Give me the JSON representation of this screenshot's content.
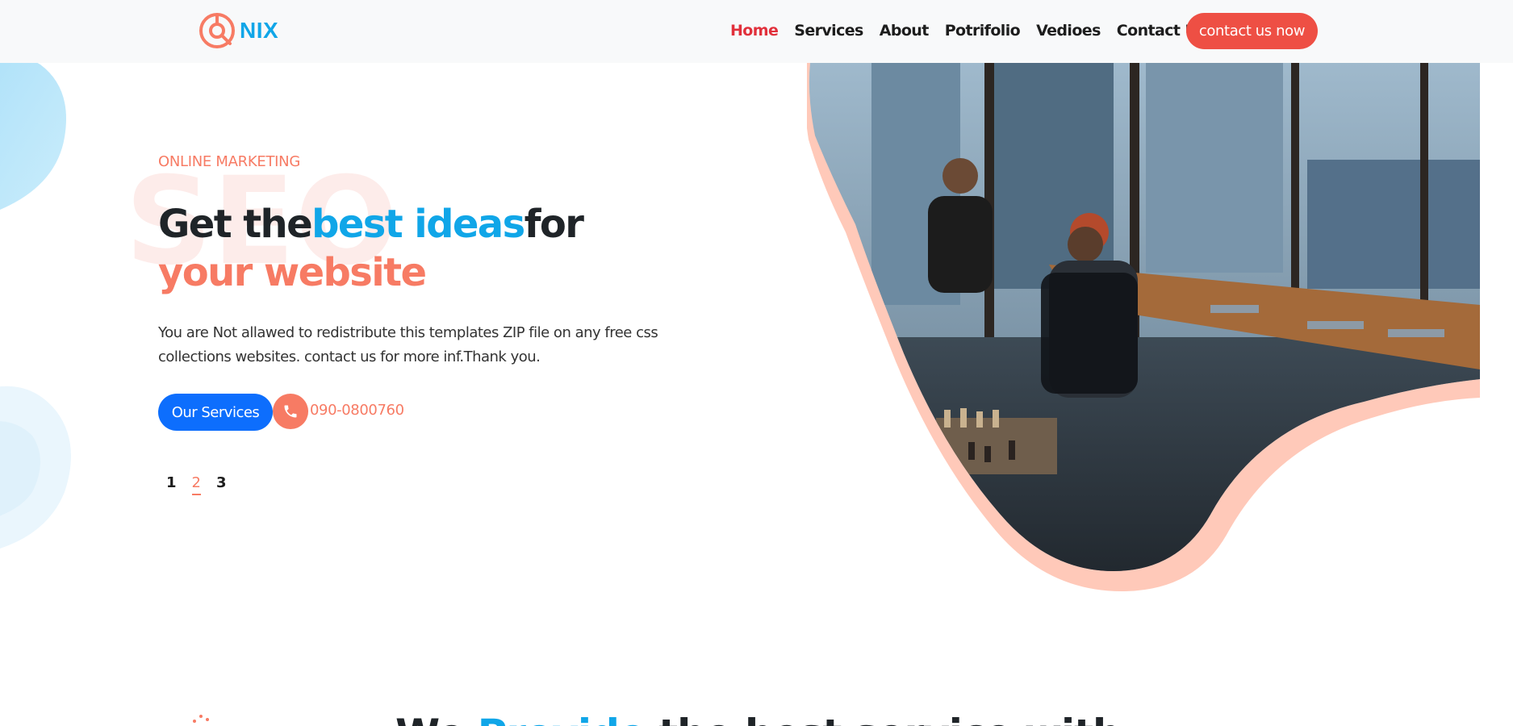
{
  "brand": {
    "name": "NIX",
    "logo_icon": "target-logo-icon"
  },
  "nav": {
    "items": [
      {
        "label": "Home",
        "active": true
      },
      {
        "label": "Services",
        "active": false
      },
      {
        "label": "About",
        "active": false
      },
      {
        "label": "Potrifolio",
        "active": false
      },
      {
        "label": "Vedioes",
        "active": false
      },
      {
        "label": "Contact Us",
        "active": false
      }
    ],
    "cta_label": "contact us now"
  },
  "hero": {
    "tag": "ONLINE MARKETING",
    "title": {
      "part1": "Get the",
      "part2": "best ideas",
      "part3": "for ",
      "part4": "your website"
    },
    "description": "You are Not allawed to redistribute this templates ZIP file on any free css collections websites. contact us for more inf.Thank you.",
    "services_button": "Our Services",
    "phone_icon": "phone-icon",
    "phone": "090-0800760",
    "watermark": "SEO",
    "pager": [
      "1",
      "2",
      "3"
    ],
    "active_page": "2",
    "image": "office-team-photo"
  },
  "next_section": {
    "title_part1": "We ",
    "title_part2": "Provide",
    "title_part3": " the best service with "
  },
  "colors": {
    "header_bg": "#f8f9fa",
    "blue": "#10a6e8",
    "coral": "#f77b64",
    "nav_active": "#e1303b",
    "cta_red": "#ee4f44",
    "primary_button": "#0d6efd",
    "dark_text": "#1f2428"
  }
}
